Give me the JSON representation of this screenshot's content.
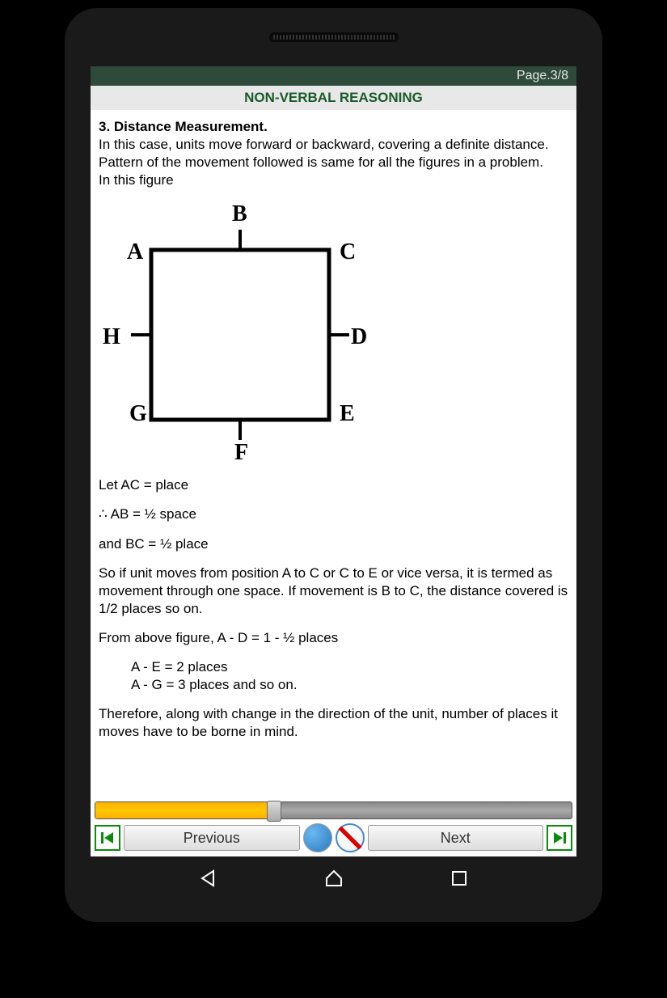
{
  "page_indicator": "Page.3/8",
  "title": "NON-VERBAL REASONING",
  "content": {
    "heading": "3. Distance Measurement.",
    "intro": "In this case, units move forward or backward, covering a definite distance. Pattern of the movement followed is same for all the figures in a problem.",
    "figure_intro": "In this figure",
    "diagram_labels": {
      "A": "A",
      "B": "B",
      "C": "C",
      "D": "D",
      "E": "E",
      "F": "F",
      "G": "G",
      "H": "H"
    },
    "line1": "Let AC = place",
    "line2": "∴ AB = ½ space",
    "line3": "and BC = ½ place",
    "para1": "So if unit moves from position A to C or C to E or vice versa, it is termed as movement through one space. If movement is B to C, the distance covered is 1/2 places so on.",
    "line4": "From above figure, A - D = 1 - ½ places",
    "line5": "A - E = 2 places",
    "line6": "A - G = 3 places and so on.",
    "para2": "Therefore, along with change in the direction of the unit, number of places it moves have to be borne in mind."
  },
  "nav": {
    "previous": "Previous",
    "next": "Next"
  },
  "progress_percent": 37
}
